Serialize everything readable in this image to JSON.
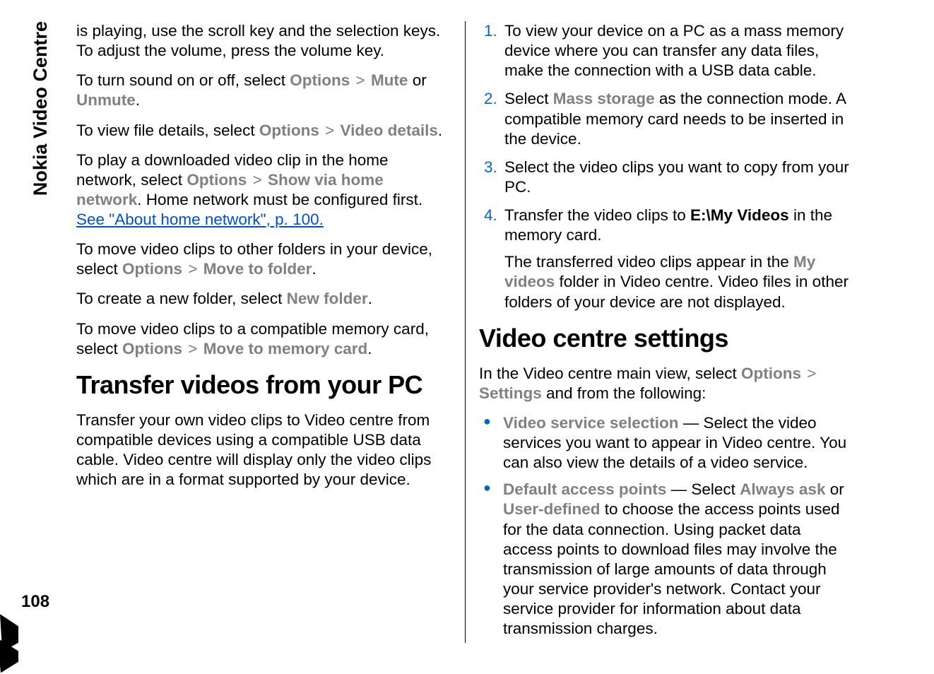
{
  "side_label": "Nokia Video Centre",
  "page_number": "108",
  "col1": {
    "p1a": "is playing, use the scroll key and the selection keys. To adjust the volume, press the volume key.",
    "p2a": "To turn sound on or off, select ",
    "p2_opt": "Options",
    "p2_mute": "Mute",
    "p2b": " or ",
    "p2_unmute": "Unmute",
    "p2c": ".",
    "p3a": "To view file details, select ",
    "p3_opt": "Options",
    "p3_vd": "Video details",
    "p3b": ".",
    "p4a": "To play a downloaded video clip in the home network, select ",
    "p4_opt": "Options",
    "p4_show": "Show via home network",
    "p4b": ". Home network must be configured first. ",
    "p4_link": "See \"About home network\", p. 100.",
    "p5a": "To move video clips to other folders in your device, select ",
    "p5_opt": "Options",
    "p5_move": "Move to folder",
    "p5b": ".",
    "p6a": "To create a new folder, select ",
    "p6_nf": "New folder",
    "p6b": ".",
    "p7a": "To move video clips to a compatible memory card, select ",
    "p7_opt": "Options",
    "p7_move": "Move to memory card",
    "p7b": ".",
    "h1": "Transfer videos from your PC",
    "p8": "Transfer your own video clips to Video centre from compatible devices using a compatible USB data cable. Video centre will display only the video clips which are in a format supported by your device.",
    "ol": {
      "li1": "To view your device on a PC as a mass memory device where you can transfer any data files, make the connection with a USB data cable.",
      "li2a": "Select ",
      "li2_ms": "Mass storage",
      "li2b": " as the connection mode. A compatible memory card needs to be inserted in the device.",
      "li3": "Select the video clips you want to copy from your PC.",
      "li4a": "Transfer the video clips to ",
      "li4_path": "E:\\My Videos",
      "li4b": " in the memory card.",
      "li4_sub_a": "The transferred video clips appear in the ",
      "li4_sub_mv": "My videos",
      "li4_sub_b": " folder in Video centre. Video files in other folders of your device are not displayed."
    }
  },
  "col2": {
    "h2": "Video centre settings",
    "p1a": "In the Video centre main view, select ",
    "p1_opt": "Options",
    "p1_set": "Settings",
    "p1b": " and from the following:",
    "ul": {
      "li1_label": "Video service selection",
      "li1_body": " — Select the video services you want to appear in Video centre. You can also view the details of a video service.",
      "li2_label": "Default access points",
      "li2_a": " — Select ",
      "li2_aa": "Always ask",
      "li2_b": " or ",
      "li2_ud": "User-defined",
      "li2_c": " to choose the access points used for the data connection. Using packet data access points to download files may involve the transmission of large amounts of data through your service provider's network. Contact your service provider for information about data transmission charges."
    }
  }
}
